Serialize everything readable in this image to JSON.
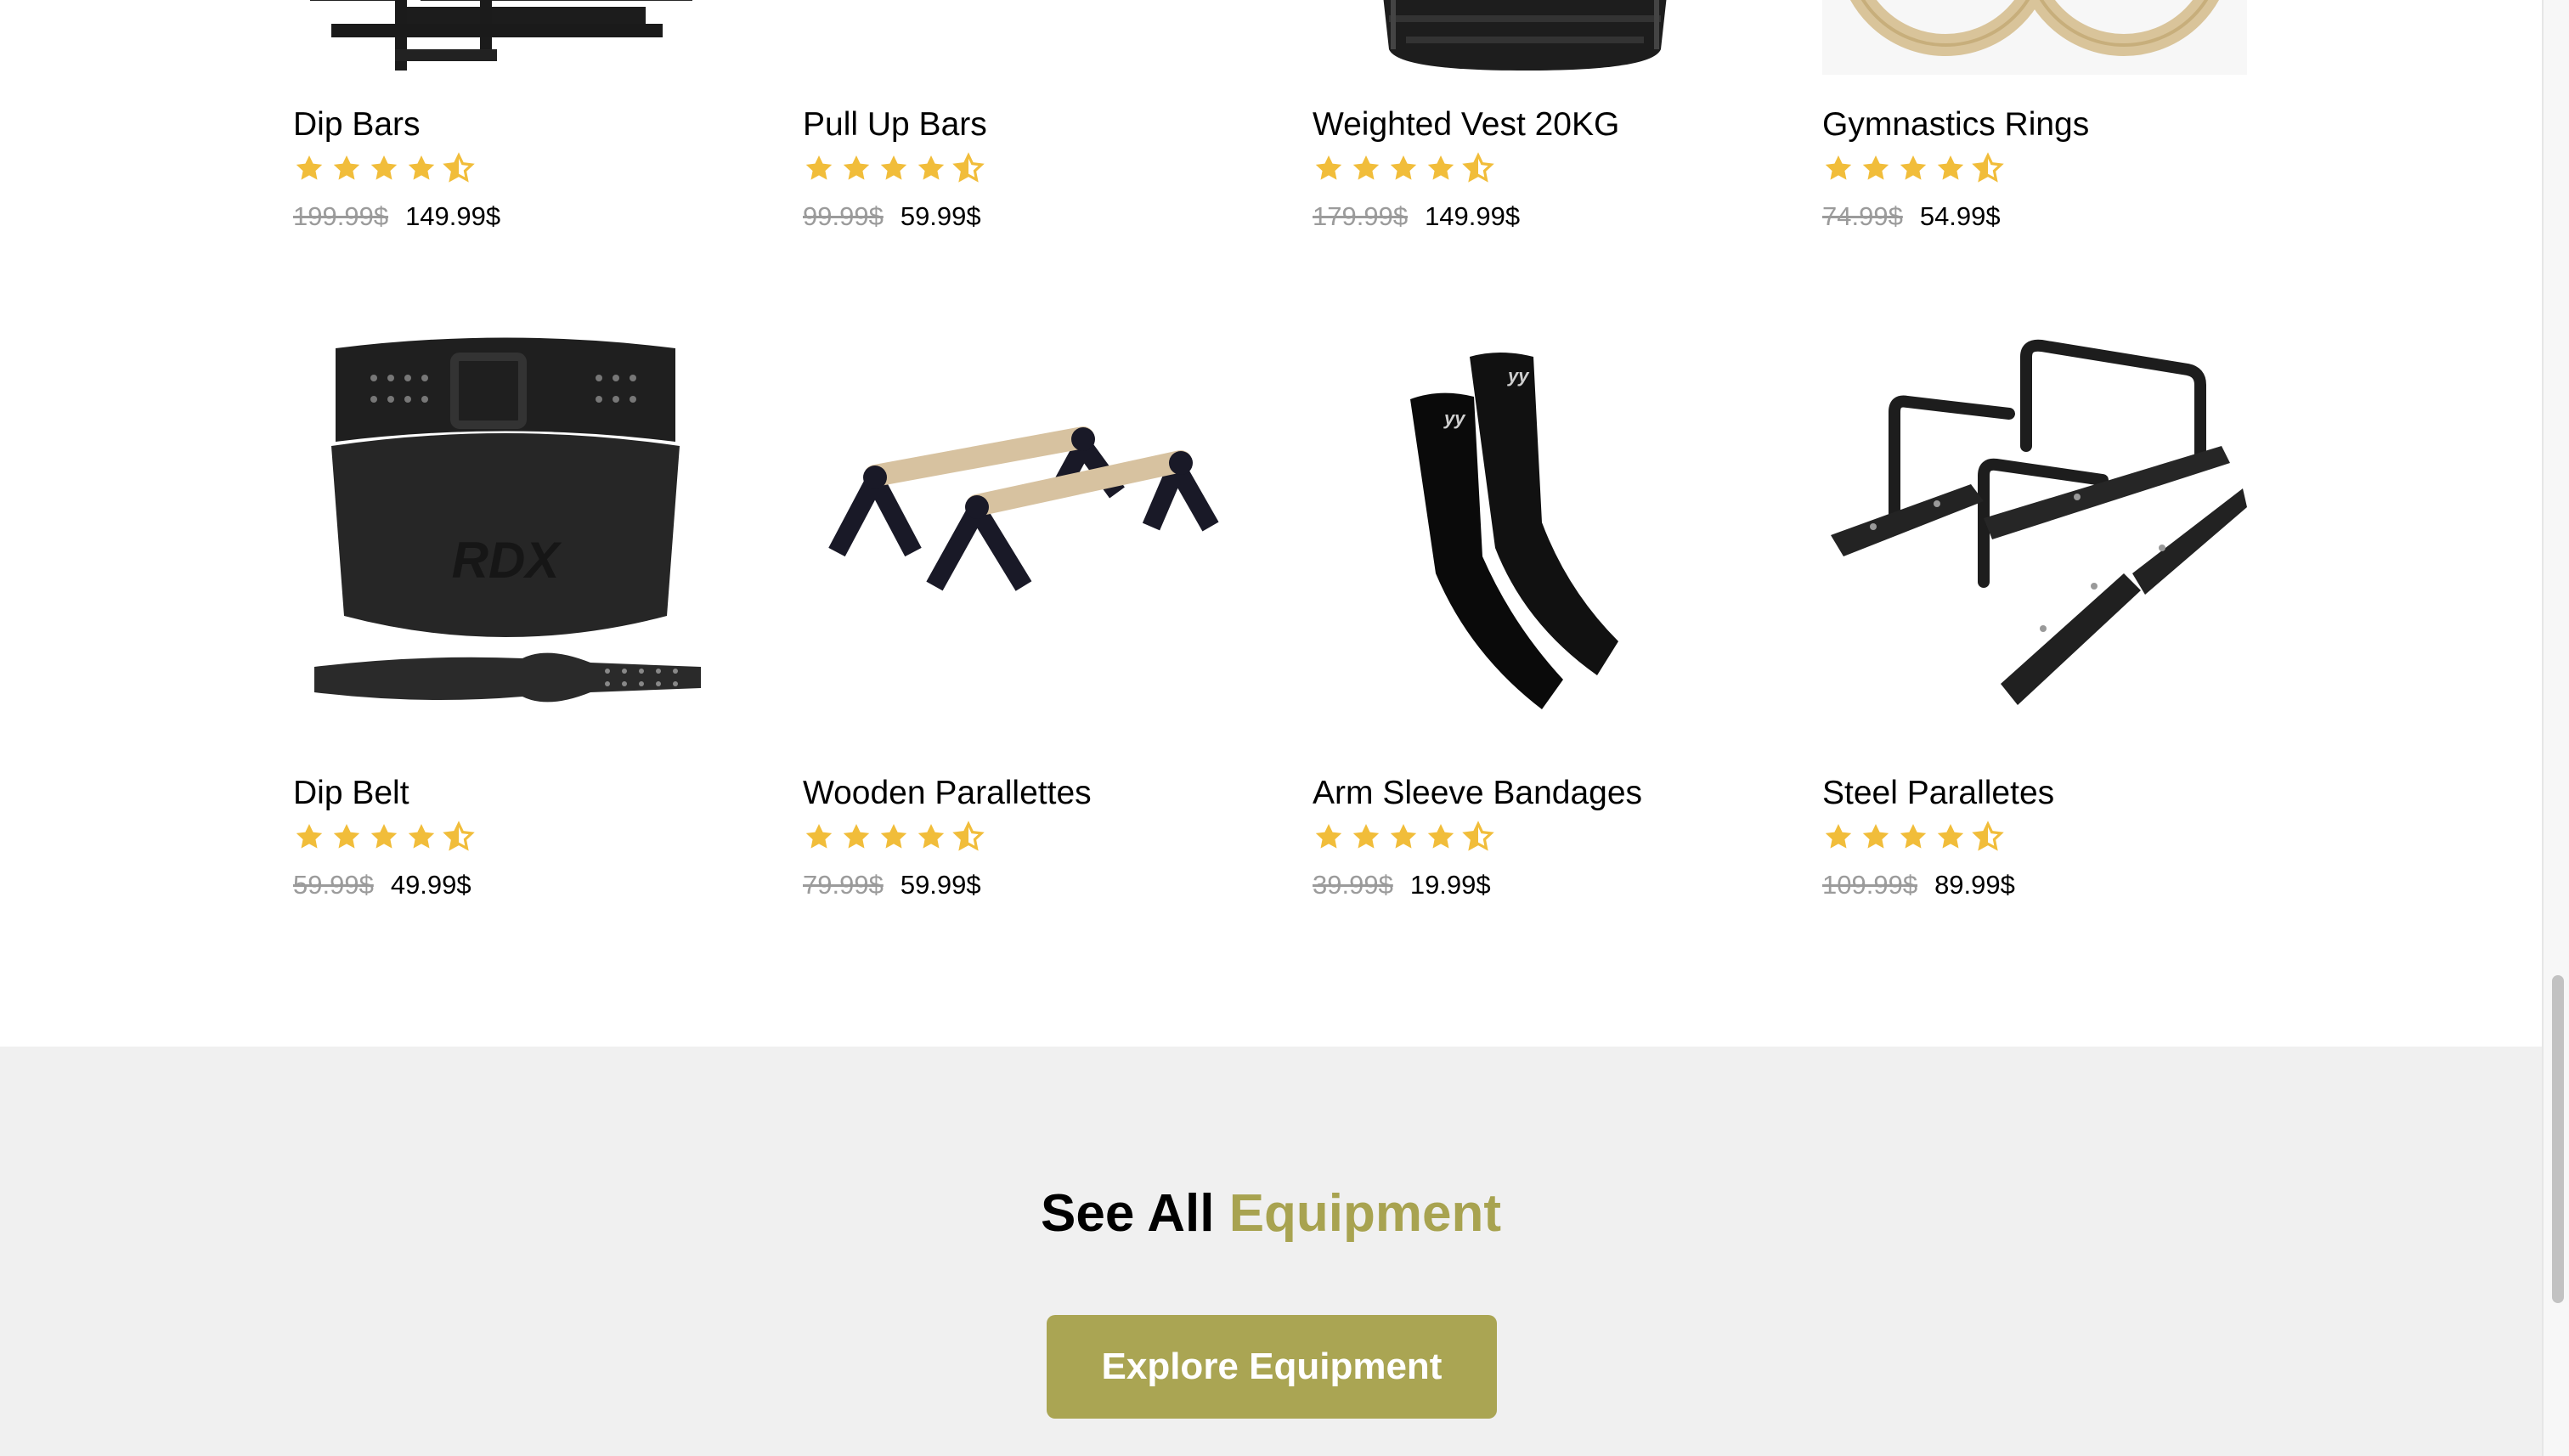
{
  "products": [
    {
      "name": "Dip Bars",
      "old_price": "199.99$",
      "price": "149.99$",
      "rating": 4.5,
      "image": "dip-bars-image"
    },
    {
      "name": "Pull Up Bars",
      "old_price": "99.99$",
      "price": "59.99$",
      "rating": 4.5,
      "image": "pull-up-bars-image"
    },
    {
      "name": "Weighted Vest 20KG",
      "old_price": "179.99$",
      "price": "149.99$",
      "rating": 4.5,
      "image": "weighted-vest-image"
    },
    {
      "name": "Gymnastics Rings",
      "old_price": "74.99$",
      "price": "54.99$",
      "rating": 4.5,
      "image": "gymnastics-rings-image"
    },
    {
      "name": "Dip Belt",
      "old_price": "59.99$",
      "price": "49.99$",
      "rating": 4.5,
      "image": "dip-belt-image",
      "brand_text": "RDX"
    },
    {
      "name": "Wooden Parallettes",
      "old_price": "79.99$",
      "price": "59.99$",
      "rating": 4.5,
      "image": "wooden-parallettes-image"
    },
    {
      "name": "Arm Sleeve Bandages",
      "old_price": "39.99$",
      "price": "19.99$",
      "rating": 4.5,
      "image": "arm-sleeve-image",
      "brand_text": "yy"
    },
    {
      "name": "Steel Paralletes",
      "old_price": "109.99$",
      "price": "89.99$",
      "rating": 4.5,
      "image": "steel-parallettes-image"
    }
  ],
  "cta": {
    "title_prefix": "See All",
    "title_accent": "Equipment",
    "button_label": "Explore Equipment"
  },
  "colors": {
    "star": "#f1bd3a",
    "accent": "#a8a350",
    "button": "#aaa553",
    "old_price": "#9b9b9b",
    "cta_background": "#f0f0f0"
  }
}
